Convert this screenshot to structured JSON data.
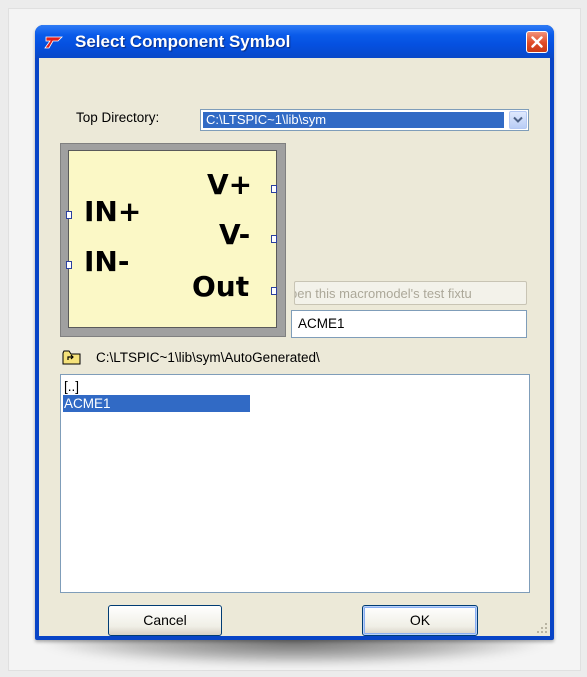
{
  "window": {
    "title": "Select Component Symbol",
    "app_icon": "ltspice-logo-icon",
    "close_icon": "close-icon"
  },
  "top_directory": {
    "label": "Top Directory:",
    "value": "C:\\LTSPIC~1\\lib\\sym"
  },
  "symbol_preview": {
    "pins_left": [
      "IN+",
      "IN-"
    ],
    "pins_right": [
      "V+",
      "V-",
      "Out"
    ]
  },
  "open_test_fixture_button": "pen this macromodel's test fixtu",
  "symbol_name": "ACME1",
  "current_path": "C:\\LTSPIC~1\\lib\\sym\\AutoGenerated\\",
  "file_list": {
    "items": [
      "[..]",
      "ACME1"
    ],
    "selected": "ACME1"
  },
  "buttons": {
    "cancel": "Cancel",
    "ok": "OK"
  },
  "colors": {
    "title_bar": "#0a5bea",
    "selection": "#316ac5",
    "symbol_background": "#fbf8c6"
  }
}
